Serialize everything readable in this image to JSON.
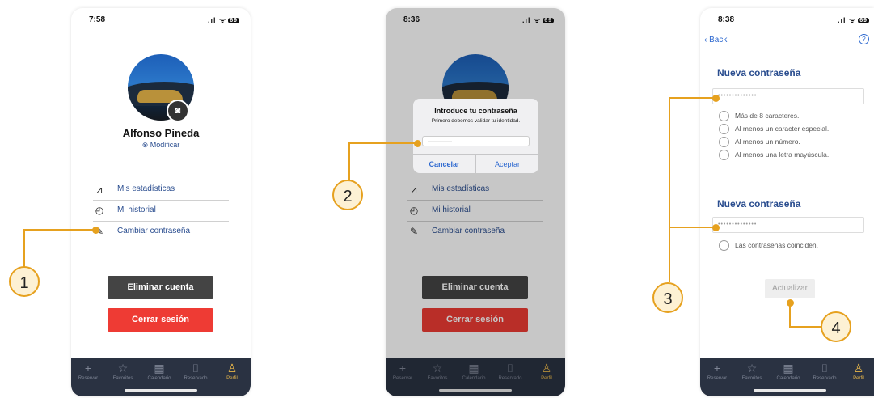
{
  "screen1": {
    "time": "7:58",
    "battery": "69",
    "user_name": "Alfonso Pineda",
    "modify_label": "⊗ Modificar",
    "menu": [
      {
        "icon": "chart-icon",
        "label": "Mis estadísticas"
      },
      {
        "icon": "clock-icon",
        "label": "Mi historial"
      },
      {
        "icon": "pencil-icon",
        "label": "Cambiar contraseña"
      }
    ],
    "delete_account": "Eliminar cuenta",
    "logout": "Cerrar sesión"
  },
  "screen2": {
    "time": "8:36",
    "battery": "69",
    "dialog_title": "Introduce tu contraseña",
    "dialog_message": "Primero debemos validar tu identidad.",
    "dialog_input": "···············",
    "cancel": "Cancelar",
    "accept": "Aceptar",
    "menu": [
      {
        "icon": "chart-icon",
        "label": "Mis estadísticas"
      },
      {
        "icon": "clock-icon",
        "label": "Mi historial"
      },
      {
        "icon": "pencil-icon",
        "label": "Cambiar contraseña"
      }
    ],
    "delete_account": "Eliminar cuenta",
    "logout": "Cerrar sesión"
  },
  "screen3": {
    "time": "8:38",
    "battery": "69",
    "back": "Back",
    "help": "?",
    "section1_title": "Nueva contraseña",
    "field1": "••••••••••••••",
    "rules": [
      "Más de 8 caracteres.",
      "Al menos un caracter especial.",
      "Al menos un número.",
      "Al menos una letra mayúscula."
    ],
    "section2_title": "Nueva contraseña",
    "field2": "••••••••••••••",
    "match_rule": "Las contraseñas coinciden.",
    "update": "Actualizar"
  },
  "tabbar": [
    "Reservar",
    "Favoritos",
    "Calendario",
    "Reservado",
    "Perfil"
  ],
  "tab_icons": [
    "plus-icon",
    "star-icon",
    "calendar-icon",
    "bookmark-icon",
    "person-icon"
  ],
  "annotations": [
    "1",
    "2",
    "3",
    "4"
  ],
  "colors": {
    "accent": "#e6a11f",
    "link": "#2a4d8f",
    "danger": "#ee3b34",
    "tabbar": "#2a3242",
    "tab_active": "#e6b54a"
  }
}
